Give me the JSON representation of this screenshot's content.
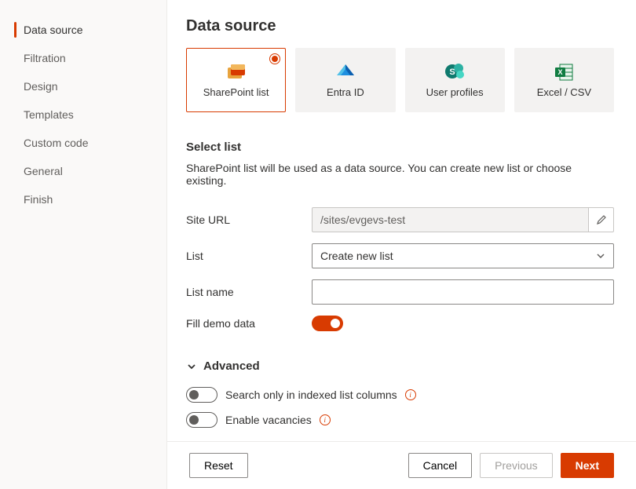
{
  "sidebar": {
    "items": [
      {
        "label": "Data source",
        "active": true
      },
      {
        "label": "Filtration",
        "active": false
      },
      {
        "label": "Design",
        "active": false
      },
      {
        "label": "Templates",
        "active": false
      },
      {
        "label": "Custom code",
        "active": false
      },
      {
        "label": "General",
        "active": false
      },
      {
        "label": "Finish",
        "active": false
      }
    ]
  },
  "page": {
    "title": "Data source"
  },
  "sources": [
    {
      "key": "sharepoint",
      "label": "SharePoint list",
      "selected": true
    },
    {
      "key": "entra",
      "label": "Entra ID",
      "selected": false
    },
    {
      "key": "profiles",
      "label": "User profiles",
      "selected": false
    },
    {
      "key": "excel",
      "label": "Excel / CSV",
      "selected": false
    }
  ],
  "select_list": {
    "heading": "Select list",
    "description": "SharePoint list will be used as a data source. You can create new list or choose existing.",
    "site_url_label": "Site URL",
    "site_url_value": "/sites/evgevs-test",
    "list_label": "List",
    "list_value": "Create new list",
    "list_name_label": "List name",
    "list_name_value": "",
    "fill_demo_label": "Fill demo data",
    "fill_demo_on": true
  },
  "advanced": {
    "heading": "Advanced",
    "search_only_label": "Search only in indexed list columns",
    "search_only_on": false,
    "vacancies_label": "Enable vacancies",
    "vacancies_on": false
  },
  "footer": {
    "reset": "Reset",
    "cancel": "Cancel",
    "previous": "Previous",
    "next": "Next"
  }
}
